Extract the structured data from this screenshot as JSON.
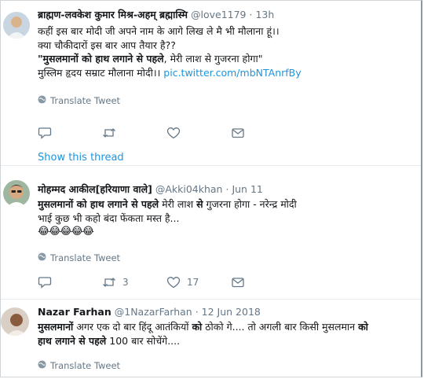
{
  "tweets": [
    {
      "name": "ब्राह्मण-लवकेश कुमार मिश्र-अहम् ब्रह्मास्मि",
      "handle": "@love1179",
      "sep": "·",
      "time": "13h",
      "lines": [
        "कहीं इस बार मोदी जी अपने नाम के आगे लिख ले मै भी मौलाना हूं।।",
        "क्या चौकीदारों इस बार आप तैयार है??",
        "मेरी लाश से गुजरना होगा\"",
        "मुस्लिम हृदय सम्राट मौलाना मोदी।।"
      ],
      "bold_quote": "\"मुसलमानों को हाथ लगाने से पहले",
      "link": "pic.twitter.com/mbNTAnrfBy",
      "translate": "Translate Tweet",
      "reply_count": "",
      "retweet_count": "",
      "like_count": "",
      "show_thread": "Show this thread"
    },
    {
      "name": "मोहम्मद आकील[हरियाणा वाले]",
      "handle": "@Akki04khan",
      "sep": "·",
      "time": "Jun 11",
      "bold_1": "मुसलमानों को हाथ लगाने से पहले",
      "mid": " मेरी लाश ",
      "bold_2": "से",
      "rest": " गुजरना होगा - नरेन्द्र मोदी",
      "line2": "भाई कुछ भी कहो बंदा फेंकता मस्त है...",
      "emojis": "😂😂😂😂😂",
      "translate": "Translate Tweet",
      "reply_count": "",
      "retweet_count": "3",
      "like_count": "17"
    },
    {
      "name": "Nazar Farhan",
      "handle": "@1NazarFarhan",
      "sep": "·",
      "time": "12 Jun 2018",
      "bold_1": "मुसलमानों",
      "mid": " अगर एक दो बार हिंदू आतंकियों ",
      "bold_2": "को",
      "rest": " ठोको गे.... तो अगली बार किसी मुसलमान ",
      "bold_3": "को",
      "line2_bold": "हाथ लगाने से पहले",
      "line2_rest": " 100 बार सोचेंगे....",
      "translate": "Translate Tweet"
    }
  ],
  "colors": {
    "link": "#1b95e0",
    "muted": "#657786",
    "text": "#14171a"
  },
  "icons": [
    "reply-icon",
    "retweet-icon",
    "like-icon",
    "share-icon",
    "globe-icon"
  ]
}
